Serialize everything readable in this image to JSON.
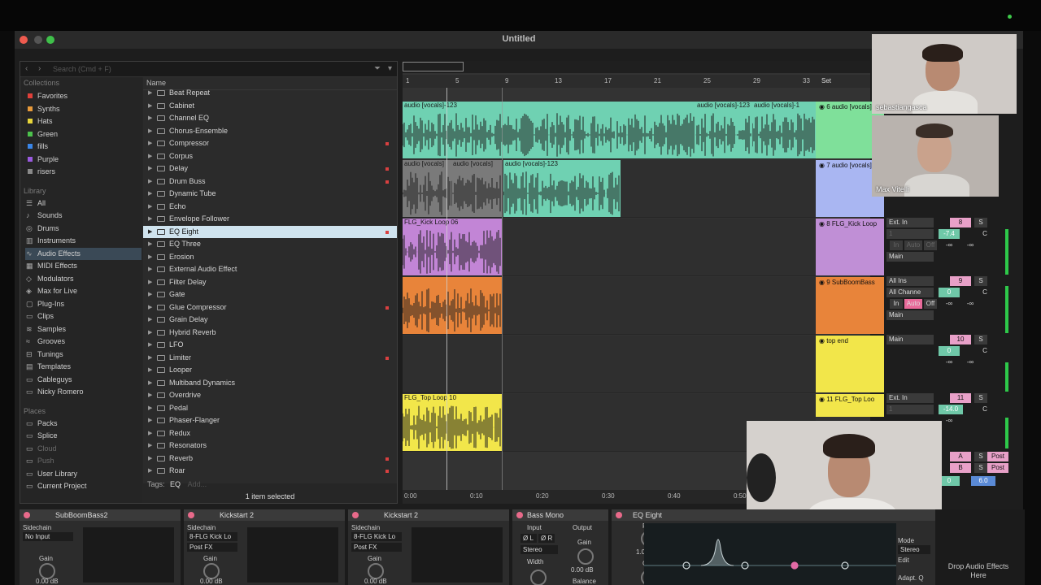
{
  "window": {
    "title": "Untitled"
  },
  "browser": {
    "search_placeholder": "Search (Cmd + F)",
    "collections_label": "Collections",
    "collections": [
      {
        "label": "Favorites",
        "color": "#e0403a"
      },
      {
        "label": "Synths",
        "color": "#e89a3a"
      },
      {
        "label": "Hats",
        "color": "#e8d63a"
      },
      {
        "label": "Green",
        "color": "#4cc24c"
      },
      {
        "label": "fills",
        "color": "#3a86e8"
      },
      {
        "label": "Purple",
        "color": "#9a5ae0"
      },
      {
        "label": "risers",
        "color": "#8a8a8a"
      }
    ],
    "library_label": "Library",
    "library": [
      {
        "label": "All",
        "icon": "grid-icon"
      },
      {
        "label": "Sounds",
        "icon": "note-icon"
      },
      {
        "label": "Drums",
        "icon": "drum-icon"
      },
      {
        "label": "Instruments",
        "icon": "keyboard-icon"
      },
      {
        "label": "Audio Effects",
        "icon": "audio-fx-icon"
      },
      {
        "label": "MIDI Effects",
        "icon": "midi-fx-icon"
      },
      {
        "label": "Modulators",
        "icon": "modulator-icon"
      },
      {
        "label": "Max for Live",
        "icon": "max-icon"
      },
      {
        "label": "Plug-Ins",
        "icon": "plugin-icon"
      },
      {
        "label": "Clips",
        "icon": "clip-icon"
      },
      {
        "label": "Samples",
        "icon": "sample-icon"
      },
      {
        "label": "Grooves",
        "icon": "groove-icon"
      },
      {
        "label": "Tunings",
        "icon": "tuning-icon"
      },
      {
        "label": "Templates",
        "icon": "template-icon"
      },
      {
        "label": "Cableguys",
        "icon": "folder-icon"
      },
      {
        "label": "Nicky Romero",
        "icon": "folder-icon"
      }
    ],
    "places_label": "Places",
    "places": [
      {
        "label": "Packs"
      },
      {
        "label": "Splice"
      },
      {
        "label": "Cloud"
      },
      {
        "label": "Push"
      },
      {
        "label": "User Library"
      },
      {
        "label": "Current Project"
      }
    ],
    "column_name": "Name",
    "items": [
      {
        "label": "Beat Repeat",
        "mark": false
      },
      {
        "label": "Cabinet",
        "mark": false
      },
      {
        "label": "Channel EQ",
        "mark": false
      },
      {
        "label": "Chorus-Ensemble",
        "mark": false
      },
      {
        "label": "Compressor",
        "mark": true
      },
      {
        "label": "Corpus",
        "mark": false
      },
      {
        "label": "Delay",
        "mark": true
      },
      {
        "label": "Drum Buss",
        "mark": true
      },
      {
        "label": "Dynamic Tube",
        "mark": false
      },
      {
        "label": "Echo",
        "mark": false
      },
      {
        "label": "Envelope Follower",
        "mark": false
      },
      {
        "label": "EQ Eight",
        "mark": true
      },
      {
        "label": "EQ Three",
        "mark": false
      },
      {
        "label": "Erosion",
        "mark": false
      },
      {
        "label": "External Audio Effect",
        "mark": false
      },
      {
        "label": "Filter Delay",
        "mark": false
      },
      {
        "label": "Gate",
        "mark": false
      },
      {
        "label": "Glue Compressor",
        "mark": true
      },
      {
        "label": "Grain Delay",
        "mark": false
      },
      {
        "label": "Hybrid Reverb",
        "mark": false
      },
      {
        "label": "LFO",
        "mark": false
      },
      {
        "label": "Limiter",
        "mark": true
      },
      {
        "label": "Looper",
        "mark": false
      },
      {
        "label": "Multiband Dynamics",
        "mark": false
      },
      {
        "label": "Overdrive",
        "mark": false
      },
      {
        "label": "Pedal",
        "mark": false
      },
      {
        "label": "Phaser-Flanger",
        "mark": false
      },
      {
        "label": "Redux",
        "mark": false
      },
      {
        "label": "Resonators",
        "mark": false
      },
      {
        "label": "Reverb",
        "mark": true
      },
      {
        "label": "Roar",
        "mark": true
      }
    ],
    "selected_item": "EQ Eight",
    "tags_label": "Tags:",
    "tags_value": "EQ",
    "tags_add": "Add...",
    "status": "1 item selected"
  },
  "arrangement": {
    "bars": [
      "1",
      "5",
      "9",
      "13",
      "17",
      "21",
      "25",
      "29",
      "33"
    ],
    "set_label": "Set",
    "times": [
      "0:00",
      "0:10",
      "0:20",
      "0:30",
      "0:40",
      "0:50"
    ],
    "clips": [
      {
        "label": "audio [vocals]-123",
        "color": "#6fd1b2"
      },
      {
        "label": "audio [vocals]-123",
        "color": "#6fd1b2"
      },
      {
        "label": "audio [vocals]-1",
        "color": "#6fd1b2"
      },
      {
        "label": "audio [vocals]-123",
        "color": "#6fd1b2"
      },
      {
        "label": "audio [vocals]",
        "color": "#7a7a7a"
      },
      {
        "label": "audio [vocals]",
        "color": "#7a7a7a"
      },
      {
        "label": "audio [vocals]-123",
        "color": "#6fd1b2"
      },
      {
        "label": "FLG_Kick Loop 06",
        "color": "#c285d6"
      },
      {
        "label": "",
        "color": "#e8843a"
      },
      {
        "label": "FLG_Top Loop 10",
        "color": "#f2e64a"
      }
    ],
    "tracks": [
      {
        "label": "6 audio [vocals]",
        "color": "#7fe09a"
      },
      {
        "label": "7 audio [vocals]",
        "color": "#a9b6f2"
      },
      {
        "label": "8 FLG_Kick Loop",
        "color": "#c08fd6"
      },
      {
        "label": "9 SubBoomBass",
        "color": "#e8843a"
      },
      {
        "label": "top end",
        "color": "#f2e64a"
      },
      {
        "label": "11 FLG_Top Loo",
        "color": "#f2e64a"
      }
    ]
  },
  "mixer": {
    "ext_in": "Ext. In",
    "one": "1",
    "main": "Main",
    "all_ins": "All Ins",
    "all_channels": "All Channe",
    "in_label": "In",
    "auto_label": "Auto",
    "off_label": "Off",
    "track_numbers": [
      "8",
      "9",
      "10",
      "11"
    ],
    "vol_8": "-7.4",
    "vol_9": "0",
    "vol_10": "0",
    "vol_11": "-14.0",
    "center": "C",
    "inf": "-∞",
    "solo": "S",
    "return_a": "A",
    "return_b": "B",
    "post": "Post",
    "master_vol": "0",
    "master_pan": "6.0"
  },
  "webcams": [
    {
      "name": "sebastiangasca"
    },
    {
      "name": "Max Vitelli"
    }
  ],
  "devices": [
    {
      "title": "SubBoomBass2",
      "sidechain": "Sidechain",
      "input": "No Input",
      "gain": "Gain",
      "gain_value": "0.00 dB"
    },
    {
      "title": "Kickstart 2",
      "sidechain": "Sidechain",
      "input": "8-FLG Kick Lo",
      "post": "Post FX",
      "gain": "Gain",
      "gain_value": "0.00 dB"
    },
    {
      "title": "Kickstart 2",
      "sidechain": "Sidechain",
      "input": "8-FLG Kick Lo",
      "post": "Post FX",
      "gain": "Gain",
      "gain_value": "0.00 dB"
    }
  ],
  "bass_mono": {
    "title": "Bass Mono",
    "input": "Input",
    "output": "Output",
    "phase_l": "Ø L",
    "phase_r": "Ø R",
    "stereo": "Stereo",
    "width": "Width",
    "gain": "Gain",
    "gain_value": "0.00 dB",
    "balance": "Balance"
  },
  "eq_eight": {
    "title": "EQ Eight",
    "freq": "Freq",
    "freq_value": "1.00 kHz",
    "gain": "Gain",
    "db_top": "12",
    "mode": "Mode",
    "mode_value": "Stereo",
    "edit": "Edit",
    "adapt": "Adapt. Q"
  },
  "drop_text": "Drop Audio Effects Here"
}
